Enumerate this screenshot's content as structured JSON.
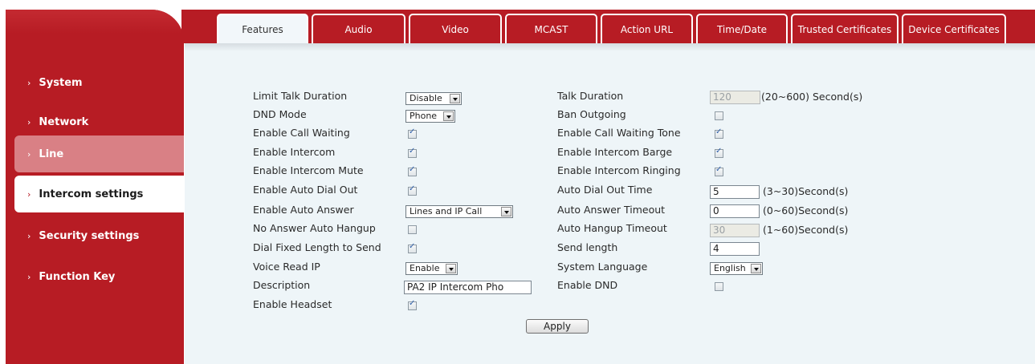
{
  "sidebar": {
    "items": [
      {
        "label": "System"
      },
      {
        "label": "Network"
      },
      {
        "label": "Line"
      },
      {
        "label": "Intercom settings"
      },
      {
        "label": "Security settings"
      },
      {
        "label": "Function Key"
      }
    ],
    "chevron": "›"
  },
  "tabs": [
    "Features",
    "Audio",
    "Video",
    "MCAST",
    "Action URL",
    "Time/Date",
    "Trusted Certificates",
    "Device Certificates"
  ],
  "form": {
    "left": [
      {
        "label": "Limit Talk Duration",
        "type": "select",
        "value": "Disable"
      },
      {
        "label": "DND Mode",
        "type": "select",
        "value": "Phone"
      },
      {
        "label": "Enable Call Waiting",
        "type": "checkbox",
        "checked": true
      },
      {
        "label": "Enable Intercom",
        "type": "checkbox",
        "checked": true
      },
      {
        "label": "Enable Intercom Mute",
        "type": "checkbox",
        "checked": true
      },
      {
        "label": "Enable Auto Dial Out",
        "type": "checkbox",
        "checked": true
      },
      {
        "label": "Enable Auto Answer",
        "type": "select",
        "value": "Lines and IP Call"
      },
      {
        "label": "No Answer Auto Hangup",
        "type": "checkbox",
        "checked": false
      },
      {
        "label": "Dial Fixed Length to Send",
        "type": "checkbox",
        "checked": true
      },
      {
        "label": "Voice Read IP",
        "type": "select",
        "value": "Enable"
      },
      {
        "label": "Description",
        "type": "text",
        "value": "PA2 IP Intercom Pho"
      },
      {
        "label": "Enable Headset",
        "type": "checkbox",
        "checked": true
      }
    ],
    "right": [
      {
        "label": "Talk Duration",
        "type": "text",
        "value": "120",
        "disabled": true,
        "unit": "(20~600) Second(s)"
      },
      {
        "label": "Ban Outgoing",
        "type": "checkbox",
        "checked": false
      },
      {
        "label": "Enable Call Waiting Tone",
        "type": "checkbox",
        "checked": true
      },
      {
        "label": "Enable Intercom Barge",
        "type": "checkbox",
        "checked": true
      },
      {
        "label": "Enable Intercom Ringing",
        "type": "checkbox",
        "checked": true
      },
      {
        "label": "Auto Dial Out Time",
        "type": "text",
        "value": "5",
        "unit": "(3~30)Second(s)"
      },
      {
        "label": "Auto Answer Timeout",
        "type": "text",
        "value": "0",
        "unit": "(0~60)Second(s)"
      },
      {
        "label": "Auto Hangup Timeout",
        "type": "text",
        "value": "30",
        "disabled": true,
        "unit": "(1~60)Second(s)"
      },
      {
        "label": "Send length",
        "type": "text",
        "value": "4"
      },
      {
        "label": "System Language",
        "type": "select",
        "value": "English"
      },
      {
        "label": "Enable DND",
        "type": "checkbox",
        "checked": false
      }
    ],
    "apply_label": "Apply"
  },
  "colors": {
    "brand_red": "#b71c24",
    "content_bg": "#eef5f8"
  }
}
